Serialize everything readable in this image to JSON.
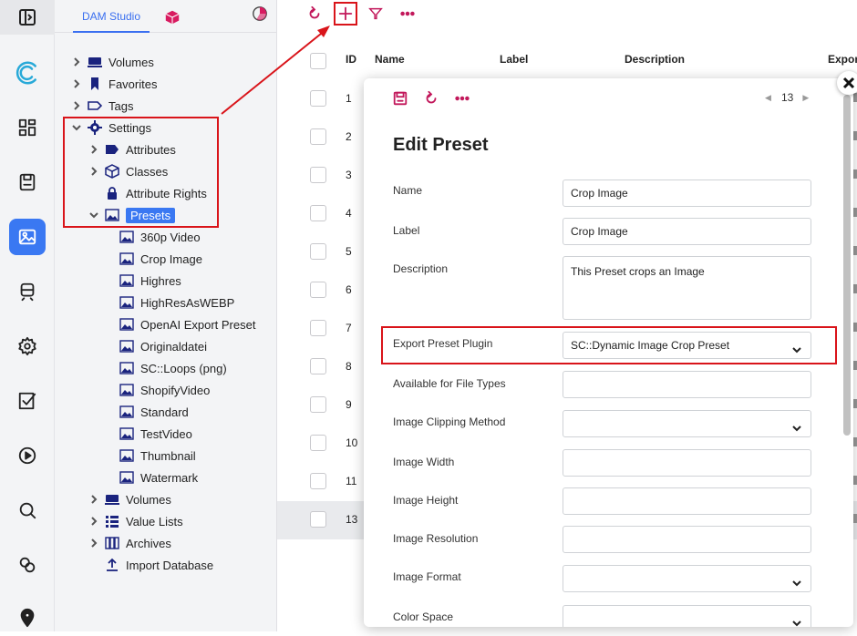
{
  "tree_tabs": {
    "dam_studio": "DAM Studio"
  },
  "tree": {
    "volumes": "Volumes",
    "favorites": "Favorites",
    "tags": "Tags",
    "settings": "Settings",
    "attributes": "Attributes",
    "classes": "Classes",
    "attribute_rights": "Attribute Rights",
    "presets": "Presets",
    "preset_items": [
      "360p Video",
      "Crop Image",
      "Highres",
      "HighResAsWEBP",
      "OpenAI Export Preset",
      "Originaldatei",
      "SC::Loops (png)",
      "ShopifyVideo",
      "Standard",
      "TestVideo",
      "Thumbnail",
      "Watermark"
    ],
    "volumes2": "Volumes",
    "value_lists": "Value Lists",
    "archives": "Archives",
    "import_database": "Import Database"
  },
  "grid": {
    "headers": {
      "id": "ID",
      "name": "Name",
      "label": "Label",
      "description": "Description",
      "export": "Expor"
    },
    "rows": [
      "1",
      "2",
      "3",
      "4",
      "5",
      "6",
      "7",
      "8",
      "9",
      "10",
      "11",
      "13"
    ]
  },
  "modal": {
    "pager": "13",
    "title": "Edit Preset",
    "fields": {
      "name_label": "Name",
      "name_value": "Crop Image",
      "label_label": "Label",
      "label_value": "Crop Image",
      "description_label": "Description",
      "description_value": "This Preset crops an Image",
      "plugin_label": "Export Preset Plugin",
      "plugin_value": "SC::Dynamic Image Crop Preset",
      "file_types_label": "Available for File Types",
      "file_types_value": "",
      "clipping_label": "Image Clipping Method",
      "clipping_value": "",
      "width_label": "Image Width",
      "width_value": "",
      "height_label": "Image Height",
      "height_value": "",
      "resolution_label": "Image Resolution",
      "resolution_value": "",
      "format_label": "Image Format",
      "format_value": "",
      "color_space_label": "Color Space",
      "color_space_value": ""
    }
  },
  "colors": {
    "accent": "#3a78f2",
    "action": "#c2185b",
    "highlight_box": "#d9141a"
  }
}
